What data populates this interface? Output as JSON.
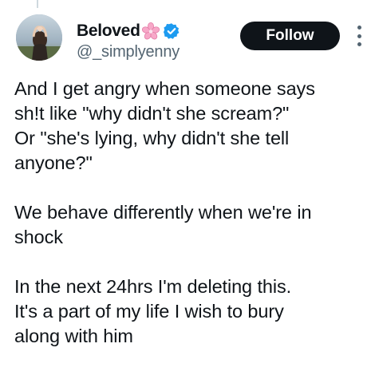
{
  "author": {
    "display_name": "Beloved",
    "handle": "@_simplyenny",
    "verified": true,
    "name_emoji": "cherry-blossom-icon"
  },
  "actions": {
    "follow_label": "Follow"
  },
  "tweet": {
    "paragraphs": [
      "And I get angry when someone says\nsh!t like \"why didn't she scream?\"\nOr \"she's lying, why didn't she tell\nanyone?\"",
      "We behave differently when we're in\nshock",
      "In the next 24hrs I'm deleting this.\nIt's a part of my life I wish to bury\nalong with him"
    ]
  },
  "colors": {
    "text": "#0f1419",
    "secondary": "#536471",
    "verified": "#1d9bf0",
    "follow_bg": "#0f1419",
    "flower": "#f7a8c8"
  }
}
